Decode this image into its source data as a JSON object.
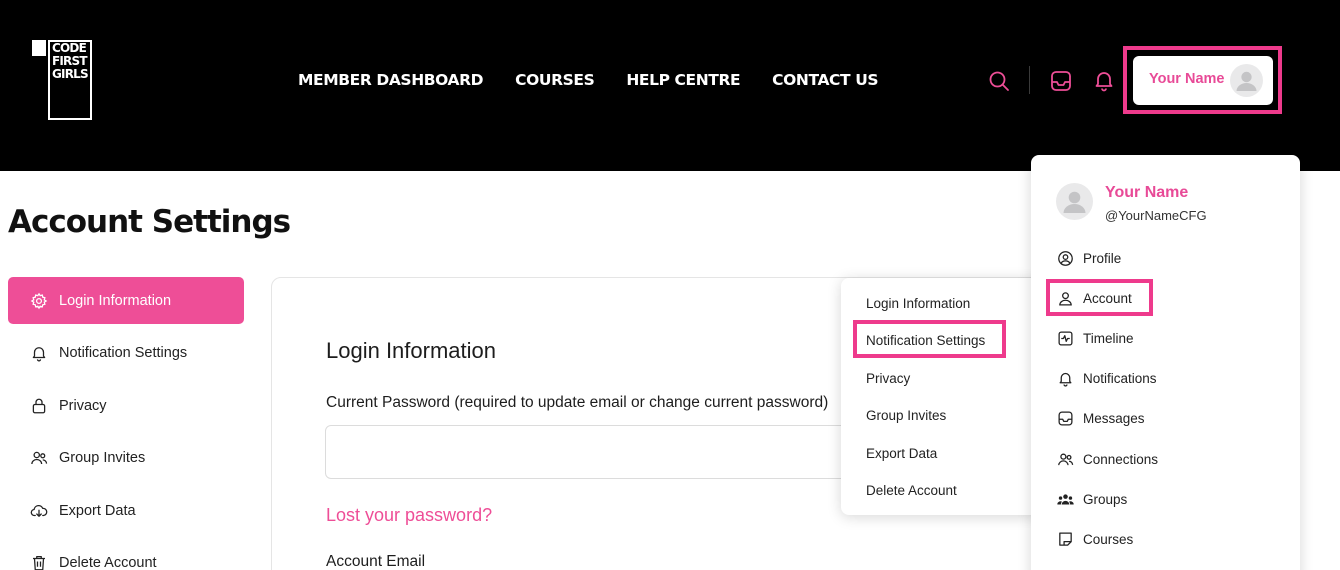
{
  "brand": {
    "logo_text": "CODE\nFIRST\nGIRLS",
    "accent": "#ee4e97",
    "header_bg": "#000000"
  },
  "nav": {
    "items": [
      "MEMBER DASHBOARD",
      "COURSES",
      "HELP CENTRE",
      "CONTACT US"
    ]
  },
  "header_icons": [
    "search-icon",
    "inbox-icon",
    "bell-icon"
  ],
  "profile_button": {
    "name": "Your Name",
    "avatar": "avatar-placeholder-icon"
  },
  "page": {
    "title": "Account Settings"
  },
  "sidebar": {
    "items": [
      {
        "label": "Login Information",
        "icon": "gear-icon",
        "active": true
      },
      {
        "label": "Notification Settings",
        "icon": "bell-icon",
        "active": false
      },
      {
        "label": "Privacy",
        "icon": "lock-icon",
        "active": false
      },
      {
        "label": "Group Invites",
        "icon": "users-icon",
        "active": false
      },
      {
        "label": "Export Data",
        "icon": "cloud-download-icon",
        "active": false
      },
      {
        "label": "Delete Account",
        "icon": "trash-icon",
        "active": false
      }
    ]
  },
  "form": {
    "section_title": "Login Information",
    "current_password_label": "Current Password (required to update email or change current password)",
    "current_password_value": "",
    "lost_password_link": "Lost your password?",
    "account_email_label": "Account Email"
  },
  "sub_dropdown": {
    "items": [
      "Login Information",
      "Notification Settings",
      "Privacy",
      "Group Invites",
      "Export Data",
      "Delete Account"
    ],
    "highlighted": "Notification Settings"
  },
  "profile_dropdown": {
    "name": "Your Name",
    "handle": "@YourNameCFG",
    "items": [
      {
        "label": "Profile",
        "icon": "user-circle-icon"
      },
      {
        "label": "Account",
        "icon": "user-icon",
        "highlighted": true
      },
      {
        "label": "Timeline",
        "icon": "activity-icon"
      },
      {
        "label": "Notifications",
        "icon": "bell-icon"
      },
      {
        "label": "Messages",
        "icon": "inbox-icon"
      },
      {
        "label": "Connections",
        "icon": "users-icon"
      },
      {
        "label": "Groups",
        "icon": "groups-icon"
      },
      {
        "label": "Courses",
        "icon": "course-icon"
      }
    ]
  }
}
